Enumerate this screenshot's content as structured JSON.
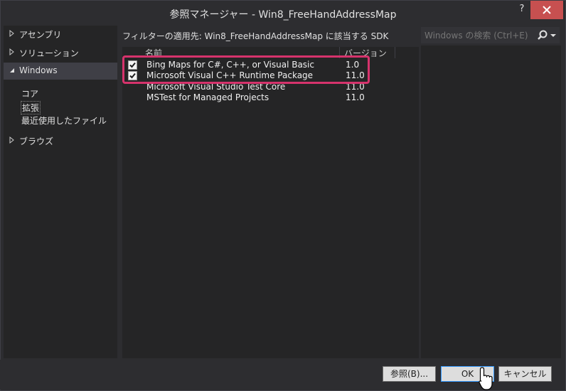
{
  "window": {
    "title": "参照マネージャー - Win8_FreeHandAddressMap",
    "help_label": "?"
  },
  "sidebar": {
    "items": [
      {
        "label": "アセンブリ",
        "expanded": false
      },
      {
        "label": "ソリューション",
        "expanded": false
      },
      {
        "label": "Windows",
        "expanded": true
      },
      {
        "label": "ブラウズ",
        "expanded": false
      }
    ],
    "windows_children": [
      "コア",
      "拡張",
      "最近使用したファイル"
    ],
    "selected_child": "拡張"
  },
  "filter": {
    "text": "フィルターの適用先: Win8_FreeHandAddressMap に該当する SDK"
  },
  "search": {
    "placeholder": "Windows の検索 (Ctrl+E)"
  },
  "list": {
    "columns": [
      "名前",
      "バージョン"
    ],
    "rows": [
      {
        "name": "Bing Maps for C#, C++, or Visual Basic",
        "version": "1.0",
        "checked": true
      },
      {
        "name": "Microsoft Visual C++ Runtime Package",
        "version": "11.0",
        "checked": true
      },
      {
        "name": "Microsoft Visual Studio Test Core",
        "version": "11.0",
        "checked": false
      },
      {
        "name": "MSTest for Managed Projects",
        "version": "11.0",
        "checked": false
      }
    ]
  },
  "buttons": {
    "browse": "参照(B)...",
    "ok": "OK",
    "cancel": "キャンセル"
  },
  "colors": {
    "background": "#2d2d30",
    "panel": "#252526",
    "highlight": "#d6336c",
    "close": "#c75050"
  }
}
